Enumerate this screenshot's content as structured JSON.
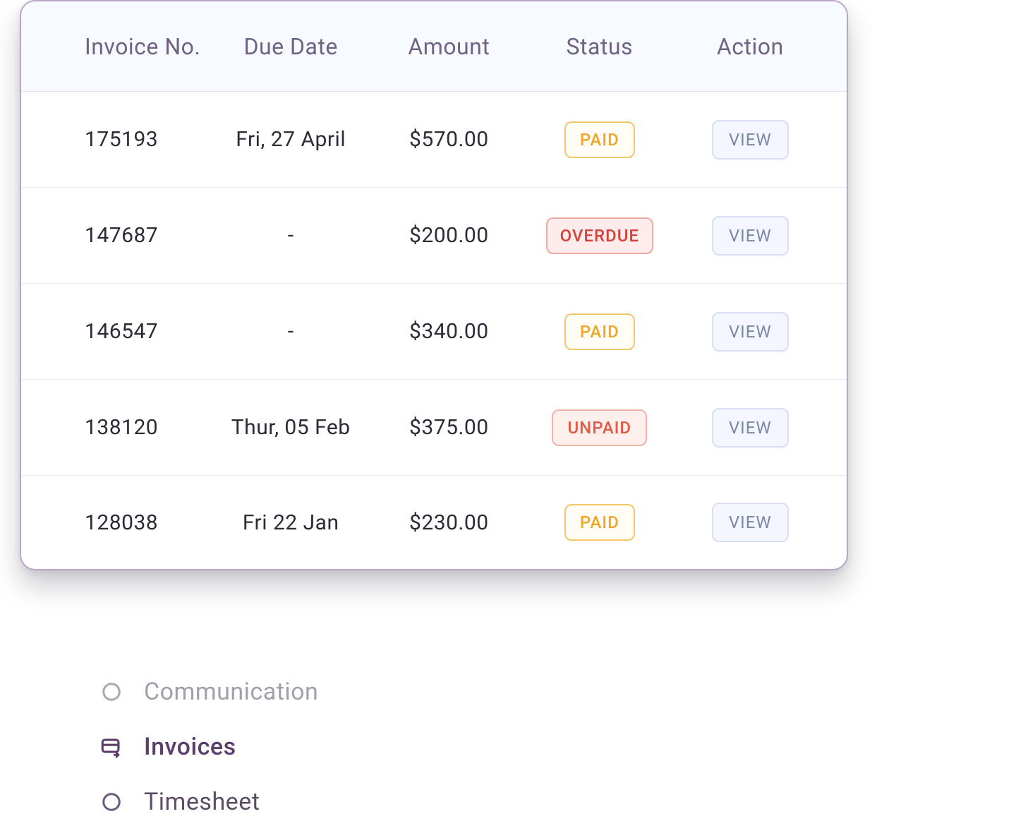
{
  "table": {
    "headers": {
      "invoice_no": "Invoice No.",
      "due_date": "Due Date",
      "amount": "Amount",
      "status": "Status",
      "action": "Action"
    },
    "view_label": "VIEW",
    "rows": [
      {
        "invoice_no": "175193",
        "due_date": "Fri, 27 April",
        "amount": "$570.00",
        "status_label": "PAID",
        "status_kind": "paid"
      },
      {
        "invoice_no": "147687",
        "due_date": "-",
        "amount": "$200.00",
        "status_label": "OVERDUE",
        "status_kind": "overdue"
      },
      {
        "invoice_no": "146547",
        "due_date": "-",
        "amount": "$340.00",
        "status_label": "PAID",
        "status_kind": "paid"
      },
      {
        "invoice_no": "138120",
        "due_date": "Thur, 05 Feb",
        "amount": "$375.00",
        "status_label": "UNPAID",
        "status_kind": "unpaid"
      },
      {
        "invoice_no": "128038",
        "due_date": "Fri 22 Jan",
        "amount": "$230.00",
        "status_label": "PAID",
        "status_kind": "paid"
      }
    ]
  },
  "background_nav": {
    "items": [
      {
        "label": "Communication",
        "icon": "circle-outline",
        "active": false,
        "faded": true
      },
      {
        "label": "Invoices",
        "icon": "invoice",
        "active": true,
        "faded": false
      },
      {
        "label": "Timesheet",
        "icon": "circle-outline",
        "active": false,
        "faded": false
      }
    ]
  },
  "colors": {
    "card_border": "#b9a5c7",
    "header_bg": "#f7faff",
    "header_text": "#6f6282",
    "row_border": "#ece8f2",
    "text": "#2e2b38",
    "paid_fg": "#f0a728",
    "paid_border": "#f5c66a",
    "overdue_fg": "#d6413a",
    "overdue_bg": "#fdeceb",
    "unpaid_fg": "#e05a45",
    "view_fg": "#7a87a4",
    "view_bg": "#f4f7ff",
    "nav_text": "#5b4e66"
  }
}
